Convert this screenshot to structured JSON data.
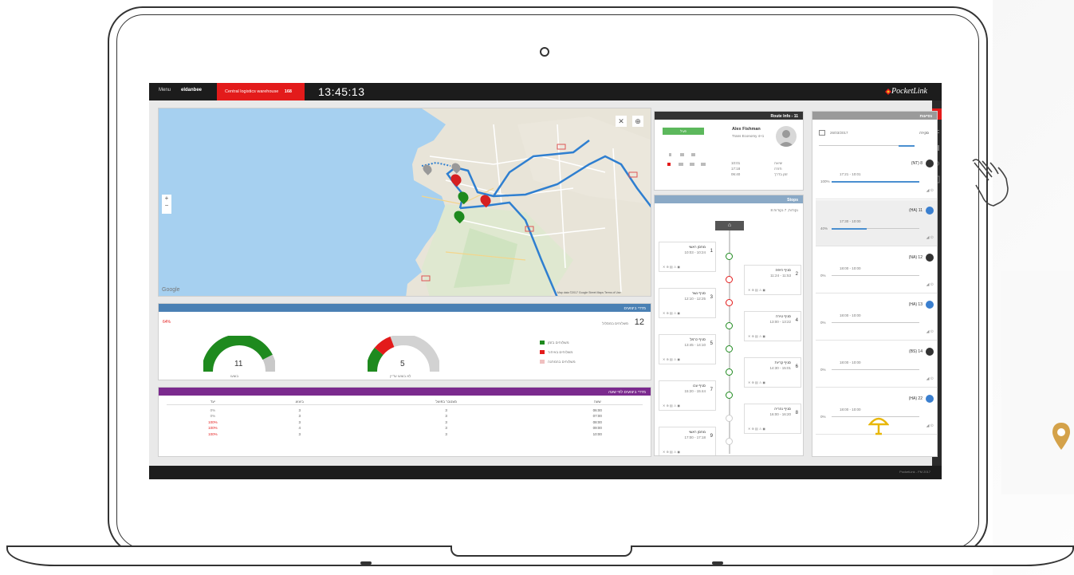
{
  "topbar": {
    "menu_label": "Menu",
    "user_label": "eldanbee",
    "alert_text": "Central logistics warehouse",
    "alert_badge": "168",
    "clock": "13:45:13",
    "logo_text": "PocketLink"
  },
  "map": {
    "attribution": "Map data ©2017 Google  Street Maps  Terms of Use",
    "google": "Google",
    "zoom_in": "+",
    "zoom_out": "−",
    "markers": [
      "1",
      "2",
      "3",
      "4",
      "5",
      "6"
    ]
  },
  "stats": {
    "title": "מדדי ביצועים",
    "count": "12",
    "count_label": "משלוחים במסלול",
    "pct": "64%",
    "legend": [
      "משלוחים בזמן",
      "משלוחים באיחור",
      "משלוחים בהמתנה"
    ],
    "gauge_green_value": "11",
    "gauge_green_label": "בוצעו",
    "gauge_red_value": "5",
    "gauge_red_label": "לא בוצעו עדיין",
    "gauge_green_level": 0.85,
    "gauge_red_level": 0.3
  },
  "table": {
    "title": "מדדי ביצועים לפי שעה",
    "headers": [
      "יעד",
      "ביצוע",
      "מצטבר בפועל",
      "שעה"
    ],
    "rows": [
      {
        "goal": "0%",
        "done": "3",
        "total": "3",
        "hour": "06:00"
      },
      {
        "goal": "0%",
        "done": "3",
        "total": "3",
        "hour": "07:00"
      },
      {
        "goal": "100%",
        "done": "3",
        "total": "3",
        "hour": "08:00"
      },
      {
        "goal": "100%",
        "done": "4",
        "total": "3",
        "hour": "09:00"
      },
      {
        "goal": "100%",
        "done": "3",
        "total": "3",
        "hour": "10:00"
      }
    ]
  },
  "route": {
    "title": "Route Info - 11",
    "status_button": "פעיל",
    "driver_name": "Alex Fishman",
    "driver_sub": "Trans Economy 4+1",
    "labels": [
      "יציאה",
      "חזרה",
      "זמן בדרך"
    ],
    "values": [
      "10:01",
      "17:18",
      "06:40"
    ]
  },
  "stops": {
    "title": "Stops",
    "summary": "8 נקודות, 7 נקודות",
    "items": [
      {
        "n": "1",
        "name": "מחסן ראשי",
        "time": "10:03 - 10:24"
      },
      {
        "n": "2",
        "name": "סניף חיפה",
        "time": "11:24 - 11:53"
      },
      {
        "n": "3",
        "name": "סניף נשר",
        "time": "12:10 - 12:25"
      },
      {
        "n": "4",
        "name": "סניף טירה",
        "time": "13:00 - 13:22"
      },
      {
        "n": "5",
        "name": "סניף כרמל",
        "time": "13:45 - 14:10"
      },
      {
        "n": "6",
        "name": "סניף קריות",
        "time": "14:30 - 15:01"
      },
      {
        "n": "7",
        "name": "סניף עכו",
        "time": "15:20 - 15:44"
      },
      {
        "n": "8",
        "name": "סניף נהריה",
        "time": "16:00 - 16:20"
      },
      {
        "n": "9",
        "name": "מחסן ראשי",
        "time": "17:00 - 17:18"
      }
    ]
  },
  "trips": {
    "title": "נסיעות",
    "date_label": "סקירה",
    "date": "26/03/2017",
    "items": [
      {
        "id": "(NT) 8",
        "time": "17:21 - 10:01",
        "pct": "100%"
      },
      {
        "id": "(HA) 11",
        "time": "17:30 - 10:00",
        "pct": "40%"
      },
      {
        "id": "(NA) 12",
        "time": "18:00 - 10:00",
        "pct": "0%"
      },
      {
        "id": "(HA) 13",
        "time": "18:00 - 10:00",
        "pct": "0%"
      },
      {
        "id": "(BS) 14",
        "time": "18:00 - 10:00",
        "pct": "0%"
      },
      {
        "id": "(HA) 22",
        "time": "18:00 - 10:00",
        "pct": "0%"
      }
    ]
  },
  "footer": {
    "text": "PocketLink - FM 2017"
  },
  "colors": {
    "accent_red": "#e31b1b",
    "accent_blue": "#4a8fd0",
    "green": "#1e8a1e",
    "purple": "#7b2a8e",
    "gold": "#d4a24a"
  }
}
